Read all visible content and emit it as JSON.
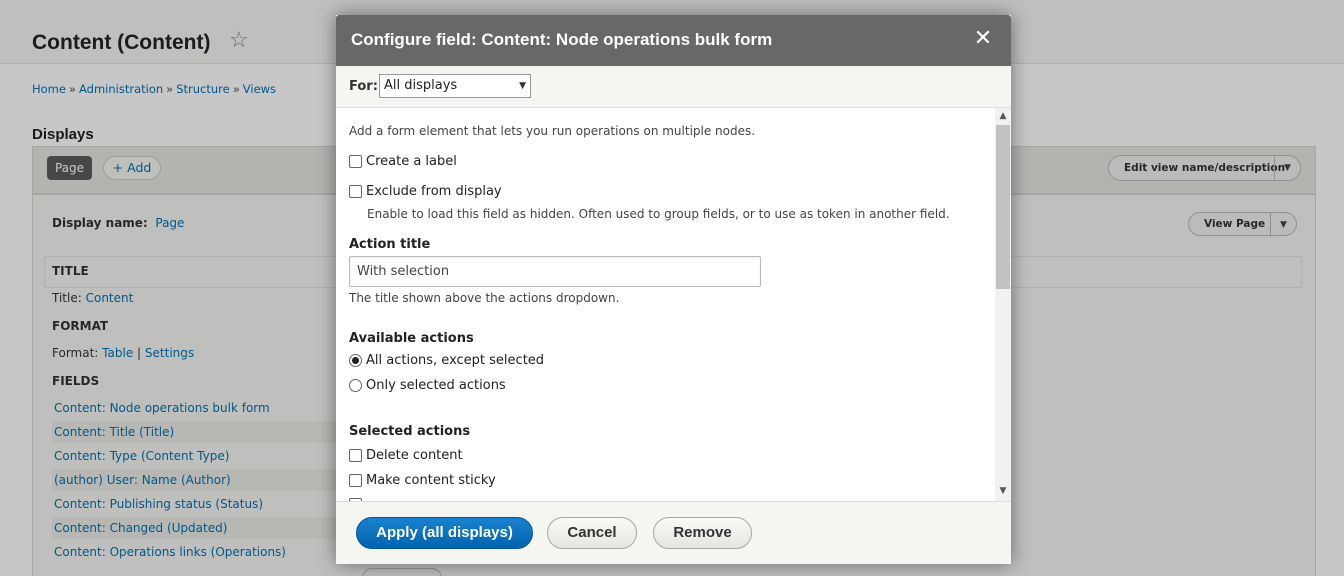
{
  "page": {
    "title": "Content (Content)",
    "breadcrumb": [
      "Home",
      "Administration",
      "Structure",
      "Views"
    ],
    "breadcrumb_sep": "»",
    "displays_heading": "Displays",
    "page_tab": "Page",
    "add_button": "+ Add",
    "edit_view_button": "Edit view name/description",
    "display_name_label": "Display name:",
    "display_name_value": "Page",
    "view_page_button": "View Page",
    "title_section": "TITLE",
    "title_label": "Title:",
    "title_value": "Content",
    "format_section": "FORMAT",
    "format_label": "Format:",
    "format_value": "Table",
    "format_sep": "|",
    "format_settings": "Settings",
    "fields_section": "FIELDS",
    "fields": [
      "Content: Node operations bulk form",
      "Content: Title (Title)",
      "Content: Type (Content Type)",
      "(author) User: Name (Author)",
      "Content: Publishing status (Status)",
      "Content: Changed (Updated)",
      "Content: Operations links (Operations)"
    ]
  },
  "dialog": {
    "title": "Configure field: Content: Node operations bulk form",
    "close_glyph": "✕",
    "for_label": "For:",
    "for_value": "All displays",
    "description": "Add a form element that lets you run operations on multiple nodes.",
    "create_label": "Create a label",
    "exclude_label": "Exclude from display",
    "exclude_desc": "Enable to load this field as hidden. Often used to group fields, or to use as token in another field.",
    "action_title_label": "Action title",
    "action_title_value": "With selection",
    "action_title_desc": "The title shown above the actions dropdown.",
    "available_actions_label": "Available actions",
    "available_actions": [
      {
        "label": "All actions, except selected",
        "selected": true
      },
      {
        "label": "Only selected actions",
        "selected": false
      }
    ],
    "selected_actions_label": "Selected actions",
    "selected_actions": [
      "Delete content",
      "Make content sticky"
    ],
    "buttons": {
      "apply": "Apply (all displays)",
      "cancel": "Cancel",
      "remove": "Remove"
    }
  },
  "colors": {
    "link": "#0071b3",
    "primary_button": "#0062ad",
    "titlebar": "#686866"
  }
}
